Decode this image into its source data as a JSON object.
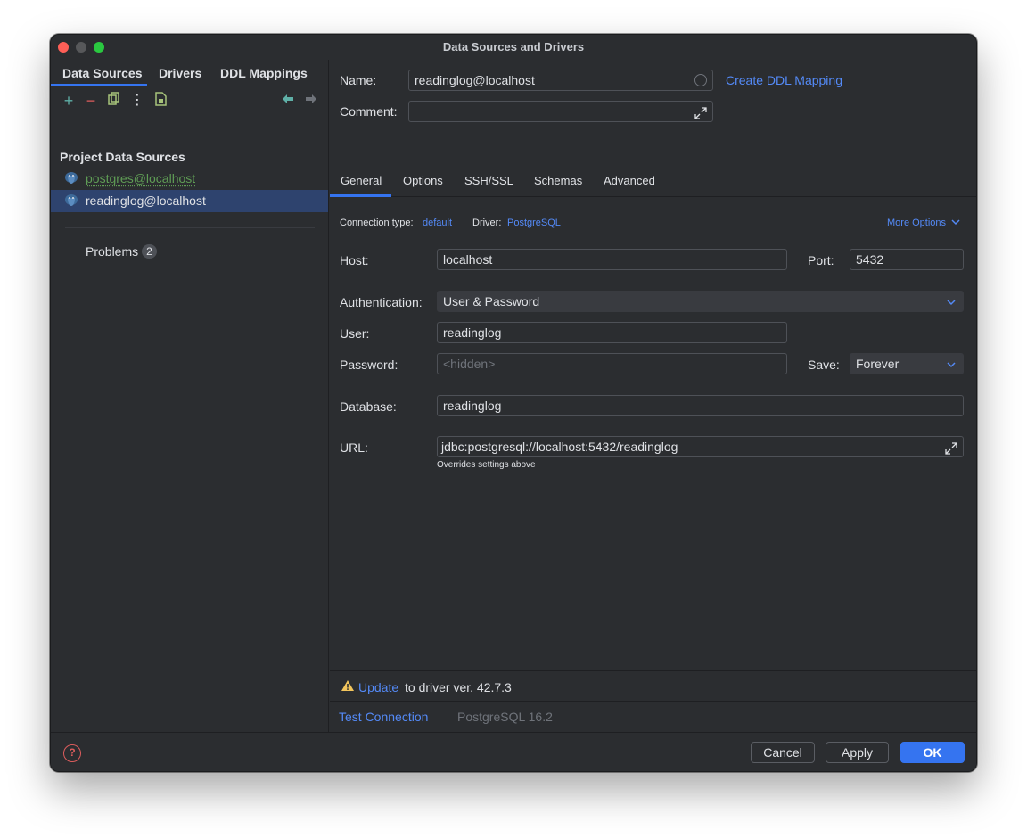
{
  "window": {
    "title": "Data Sources and Drivers"
  },
  "left": {
    "tabs": [
      "Data Sources",
      "Drivers",
      "DDL Mappings"
    ],
    "toolbar": {
      "add": "+",
      "remove": "−",
      "copy": "⧉",
      "more": "⋮",
      "sql": "▣",
      "back": "←",
      "forward": "→"
    },
    "section_title": "Project Data Sources",
    "items": [
      {
        "label": "postgres@localhost"
      },
      {
        "label": "readinglog@localhost"
      }
    ],
    "problems_label": "Problems",
    "problems_count": "2"
  },
  "right": {
    "name_label": "Name:",
    "name_value": "readinglog@localhost",
    "create_ddl_link": "Create DDL Mapping",
    "comment_label": "Comment:",
    "comment_value": "",
    "tabs": [
      "General",
      "Options",
      "SSH/SSL",
      "Schemas",
      "Advanced"
    ],
    "connection_type_label": "Connection type:",
    "connection_type_value": "default",
    "driver_label": "Driver:",
    "driver_value": "PostgreSQL",
    "more_options": "More Options",
    "host_label": "Host:",
    "host_value": "localhost",
    "port_label": "Port:",
    "port_value": "5432",
    "auth_label": "Authentication:",
    "auth_value": "User & Password",
    "user_label": "User:",
    "user_value": "readinglog",
    "password_label": "Password:",
    "password_placeholder": "<hidden>",
    "save_label": "Save:",
    "save_value": "Forever",
    "database_label": "Database:",
    "database_value": "readinglog",
    "url_label": "URL:",
    "url_value": "jdbc:postgresql://localhost:5432/readinglog",
    "url_hint": "Overrides settings above",
    "update_link": "Update",
    "update_text": "to driver ver. 42.7.3",
    "test_connection": "Test Connection",
    "server_version": "PostgreSQL 16.2"
  },
  "footer": {
    "cancel": "Cancel",
    "apply": "Apply",
    "ok": "OK",
    "help": "?"
  },
  "colors": {
    "accent": "#3574f0",
    "link": "#548af7",
    "green": "#5f9c55",
    "warning": "#f2c55c",
    "danger": "#db5c5c"
  }
}
